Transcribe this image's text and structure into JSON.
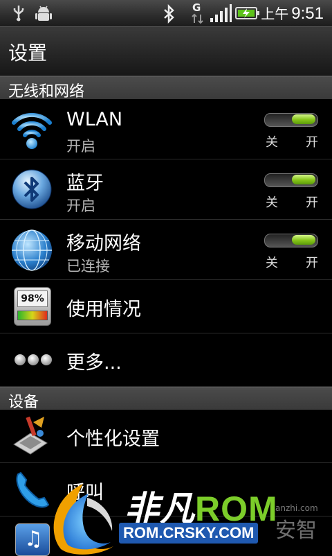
{
  "status_bar": {
    "icons": [
      "usb-icon",
      "android-debug-icon",
      "bluetooth-icon",
      "data-g-icon",
      "signal-icon",
      "battery-charging-icon"
    ],
    "data_type": "G",
    "ampm": "上午",
    "time": "9:51"
  },
  "header": {
    "title": "设置"
  },
  "sections": {
    "wireless": "无线和网络",
    "device": "设备"
  },
  "rows": {
    "wlan": {
      "label": "WLAN",
      "status": "开启",
      "toggle_off": "关",
      "toggle_on": "开",
      "enabled": true
    },
    "bluetooth": {
      "label": "蓝牙",
      "status": "开启",
      "toggle_off": "关",
      "toggle_on": "开",
      "enabled": true
    },
    "mobile": {
      "label": "移动网络",
      "status": "已连接",
      "toggle_off": "关",
      "toggle_on": "开",
      "enabled": true
    },
    "usage": {
      "label": "使用情况",
      "meter_text": "98%"
    },
    "more": {
      "label": "更多..."
    },
    "personalize": {
      "label": "个性化设置"
    },
    "call": {
      "label": "呼叫"
    }
  },
  "watermark": {
    "brand_cn": "非凡",
    "brand_en": "ROM",
    "url": "ROM.CRSKY.COM",
    "partner": "安智",
    "partner_url": "anzhi.com"
  },
  "colors": {
    "toggle_on": "#86c41a",
    "url_bg": "#1f59b0"
  }
}
